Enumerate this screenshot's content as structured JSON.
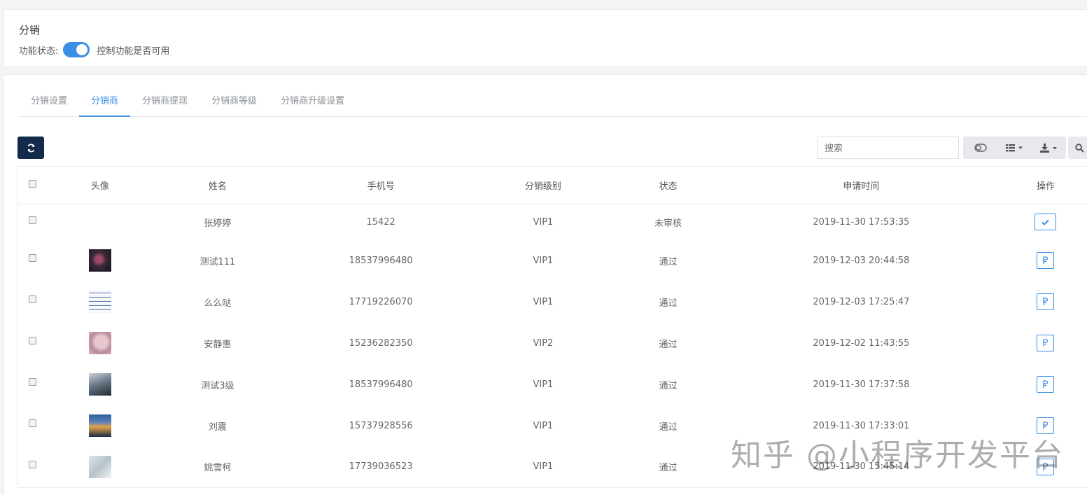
{
  "module": {
    "title": "分销",
    "status_label": "功能状态:",
    "status_hint": "控制功能是否可用",
    "enabled": true
  },
  "tabs": [
    {
      "label": "分销设置",
      "active": false
    },
    {
      "label": "分销商",
      "active": true
    },
    {
      "label": "分销商提现",
      "active": false
    },
    {
      "label": "分销商等级",
      "active": false
    },
    {
      "label": "分销商升级设置",
      "active": false
    }
  ],
  "toolbar": {
    "search_placeholder": "搜索",
    "icons": [
      "refresh-icon",
      "toggle-columns-icon",
      "list-view-icon",
      "export-icon",
      "search-icon"
    ]
  },
  "table": {
    "headers": [
      "头像",
      "姓名",
      "手机号",
      "分销级别",
      "状态",
      "申请时间",
      "操作"
    ],
    "rows": [
      {
        "avatar": "",
        "name": "张婷婷",
        "phone": "15422",
        "level": "VIP1",
        "status": "未审核",
        "time": "2019-11-30 17:53:35",
        "action": "approve"
      },
      {
        "avatar": "night-sky-photo",
        "name": "测试111",
        "phone": "18537996480",
        "level": "VIP1",
        "status": "通过",
        "time": "2019-12-03 20:44:58",
        "action": "detail"
      },
      {
        "avatar": "screenshot-photo",
        "name": "么么哒",
        "phone": "17719226070",
        "level": "VIP1",
        "status": "通过",
        "time": "2019-12-03 17:25:47",
        "action": "detail"
      },
      {
        "avatar": "portrait-photo",
        "name": "安静惠",
        "phone": "15236282350",
        "level": "VIP2",
        "status": "通过",
        "time": "2019-12-02 11:43:55",
        "action": "detail"
      },
      {
        "avatar": "landscape-photo",
        "name": "测试3级",
        "phone": "18537996480",
        "level": "VIP1",
        "status": "通过",
        "time": "2019-11-30 17:37:58",
        "action": "detail"
      },
      {
        "avatar": "sunset-photo",
        "name": "刘震",
        "phone": "15737928556",
        "level": "VIP1",
        "status": "通过",
        "time": "2019-11-30 17:33:01",
        "action": "detail"
      },
      {
        "avatar": "blurred-photo",
        "name": "姚雪柯",
        "phone": "17739036523",
        "level": "VIP1",
        "status": "通过",
        "time": "2019-11-30 15:45:14",
        "action": "detail"
      }
    ]
  },
  "watermark": "知乎 @小程序开发平台",
  "colors": {
    "accent": "#3a8ee6",
    "dark_button": "#132a4a"
  }
}
